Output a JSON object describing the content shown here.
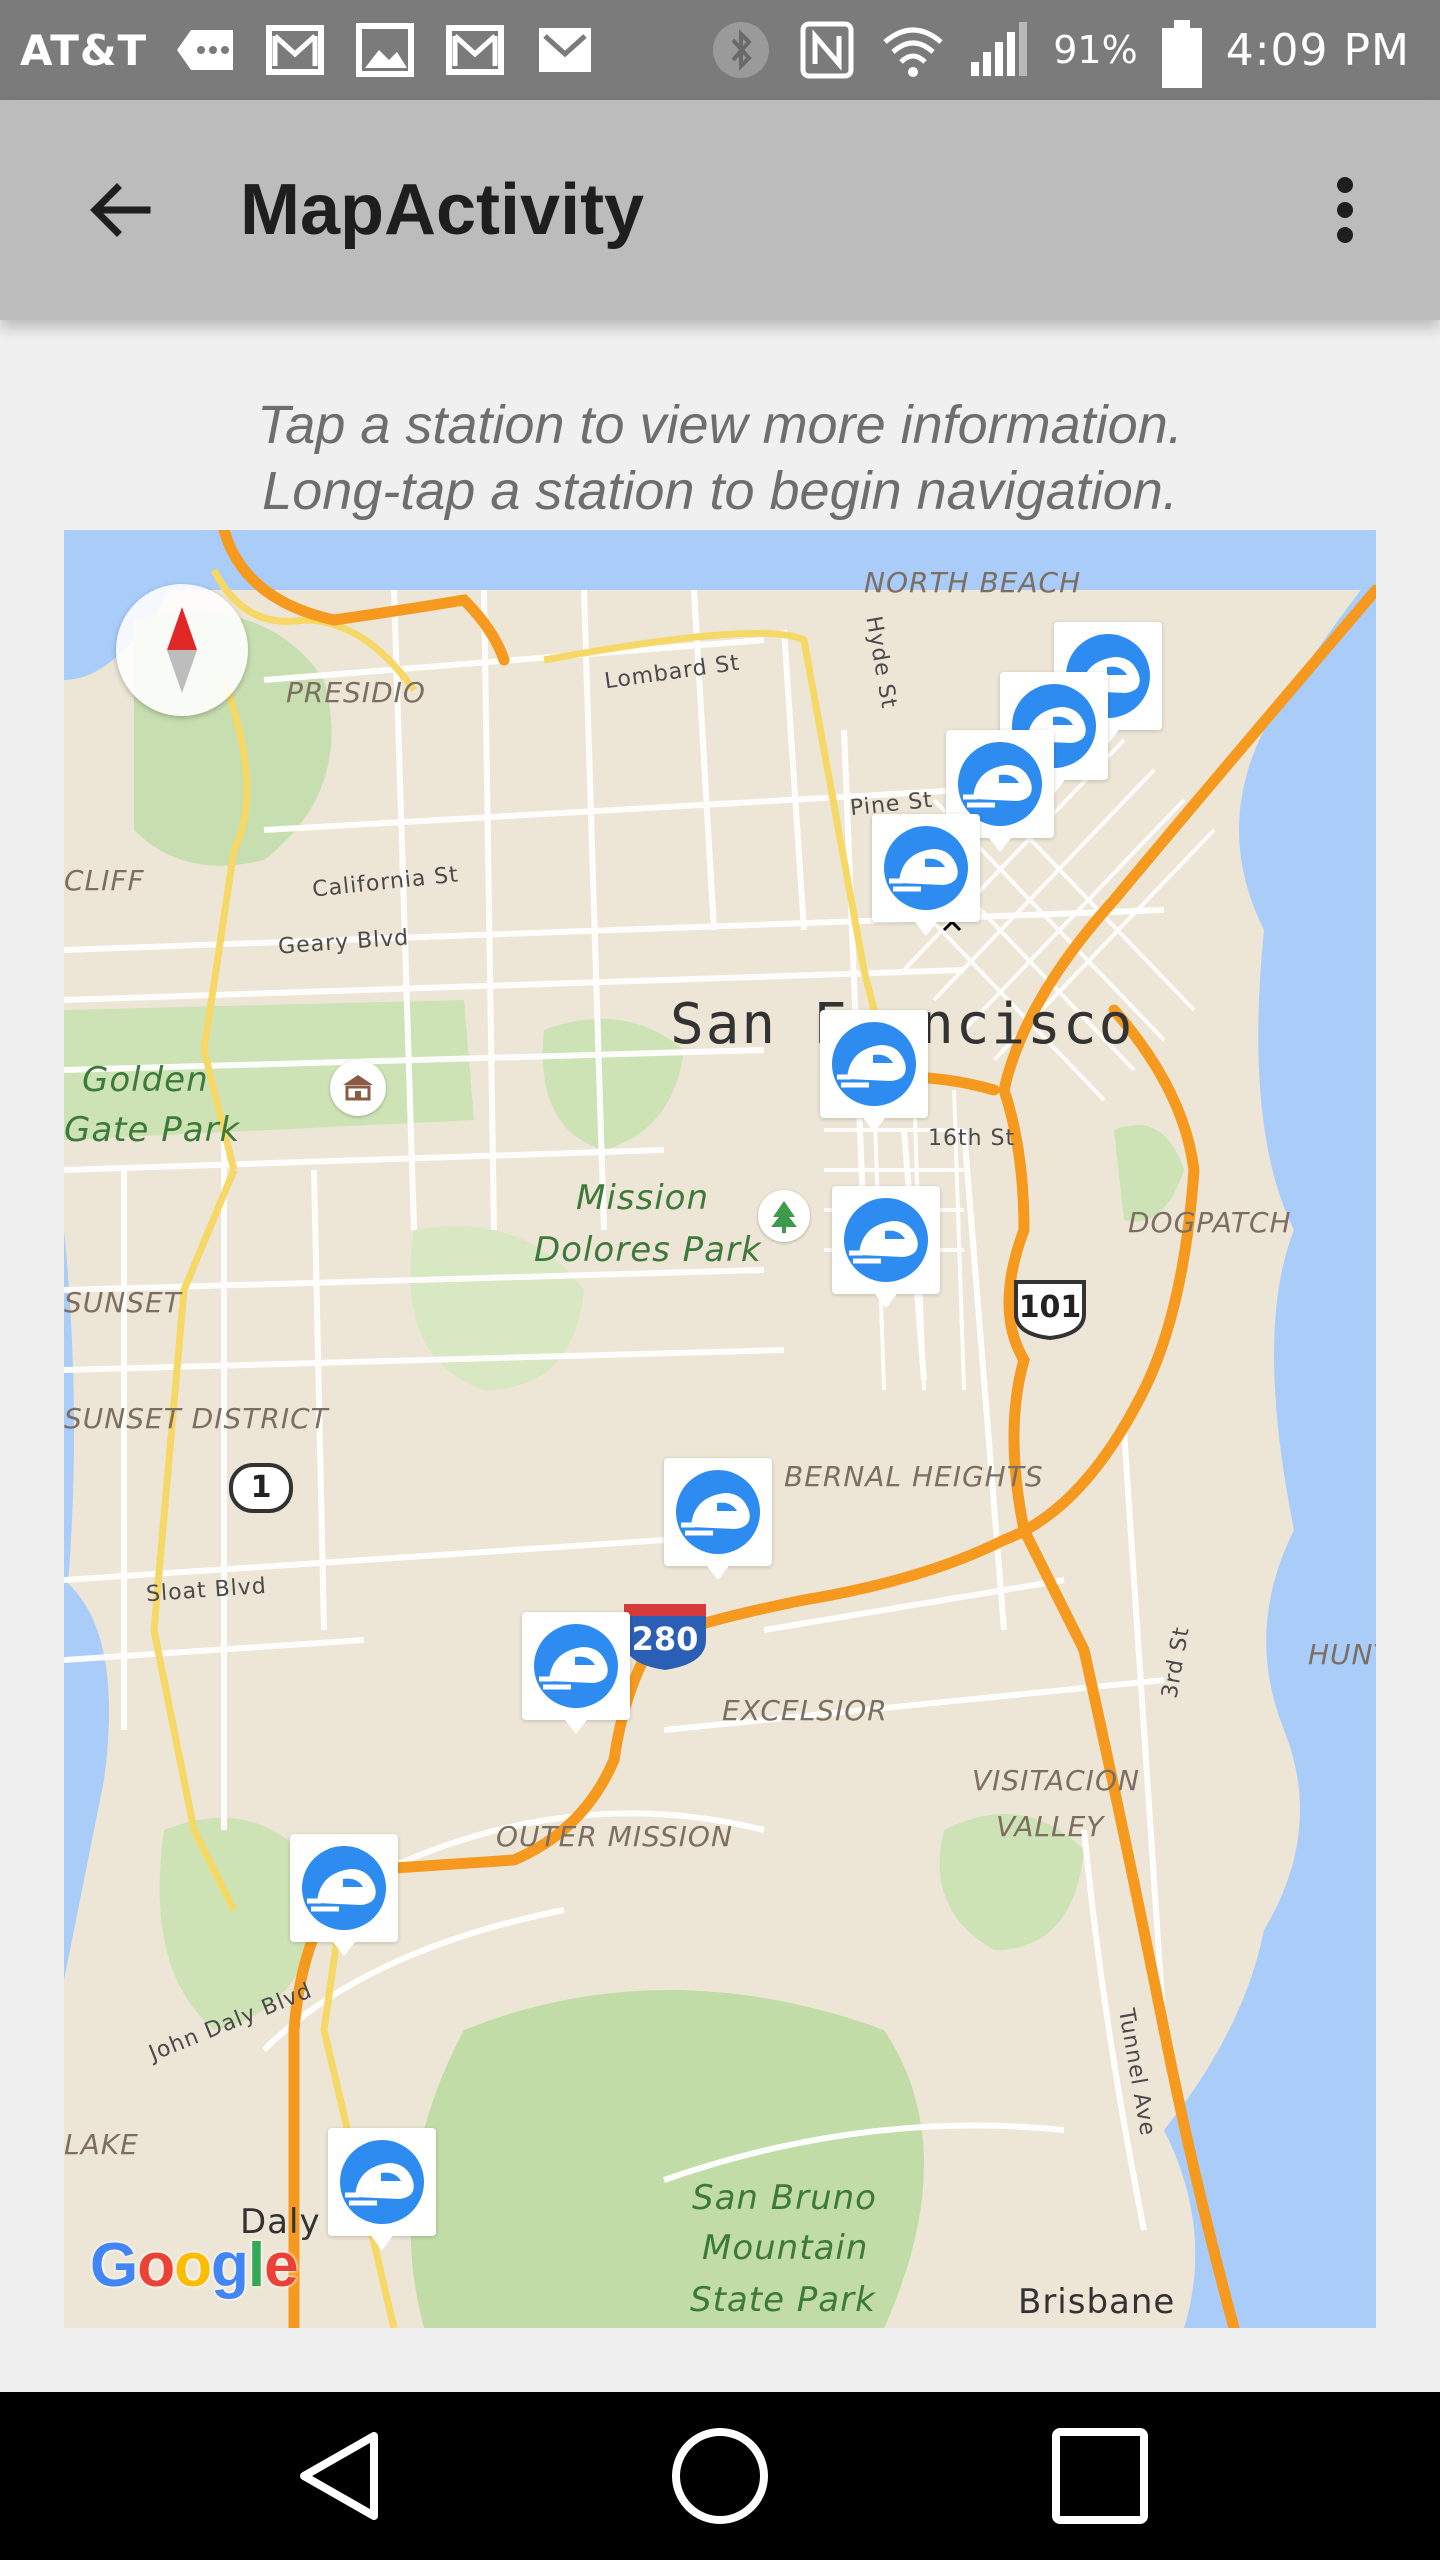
{
  "status_bar": {
    "carrier": "AT&T",
    "battery_percent": "91%",
    "time": "4:09 PM",
    "icons": [
      "message-icon",
      "gmail-icon",
      "image-icon",
      "gmail-icon",
      "gmail-icon",
      "bluetooth-icon",
      "nfc-icon",
      "wifi-icon",
      "signal-icon",
      "battery-icon"
    ]
  },
  "app_bar": {
    "title": "MapActivity",
    "back_icon": "arrow-back-icon",
    "overflow_icon": "more-vert-icon"
  },
  "instructions": {
    "line1": "Tap a station to view more information.",
    "line2": "Long-tap a station to begin navigation."
  },
  "map": {
    "city_label": "San Francisco",
    "area_labels": {
      "north_beach": "NORTH BEACH",
      "presidio": "PRESIDIO",
      "cliff": "CLIFF",
      "golden_gate_park_1": "Golden",
      "golden_gate_park_2": "Gate Park",
      "mission_dolores_1": "Mission",
      "mission_dolores_2": "Dolores Park",
      "sunset": "SUNSET",
      "sunset_district": "SUNSET DISTRICT",
      "dogpatch": "DOGPATCH",
      "bernal_heights": "BERNAL HEIGHTS",
      "excelsior": "EXCELSIOR",
      "visitacion_1": "VISITACION",
      "visitacion_2": "VALLEY",
      "outer_mission": "OUTER MISSION",
      "hunt": "HUNT",
      "lake": "LAKE",
      "daly_city": "Daly City",
      "san_bruno_1": "San Bruno",
      "san_bruno_2": "Mountain",
      "san_bruno_3": "State Park",
      "brisbane": "Brisbane"
    },
    "street_labels": {
      "lombard": "Lombard St",
      "hyde": "Hyde St",
      "pine": "Pine St",
      "california": "California St",
      "geary": "Geary Blvd",
      "sixteenth": "16th St",
      "sloat": "Sloat Blvd",
      "john_daly": "John Daly Blvd",
      "third": "3rd St",
      "tunnel": "Tunnel Ave"
    },
    "highway_shields": {
      "us101": "101",
      "ca1": "1",
      "i280": "280"
    },
    "station_icon": "train-station-icon",
    "station_count": 10,
    "attribution": "Google",
    "brand_colors": {
      "station_blue": "#2e8bf0",
      "highway_orange": "#f59a1e",
      "water": "#a9cdf8",
      "park_green": "#cde3b5",
      "land": "#ede6d6"
    }
  },
  "nav_bar": {
    "back_icon": "nav-back-icon",
    "home_icon": "nav-home-icon",
    "recents_icon": "nav-recents-icon"
  }
}
